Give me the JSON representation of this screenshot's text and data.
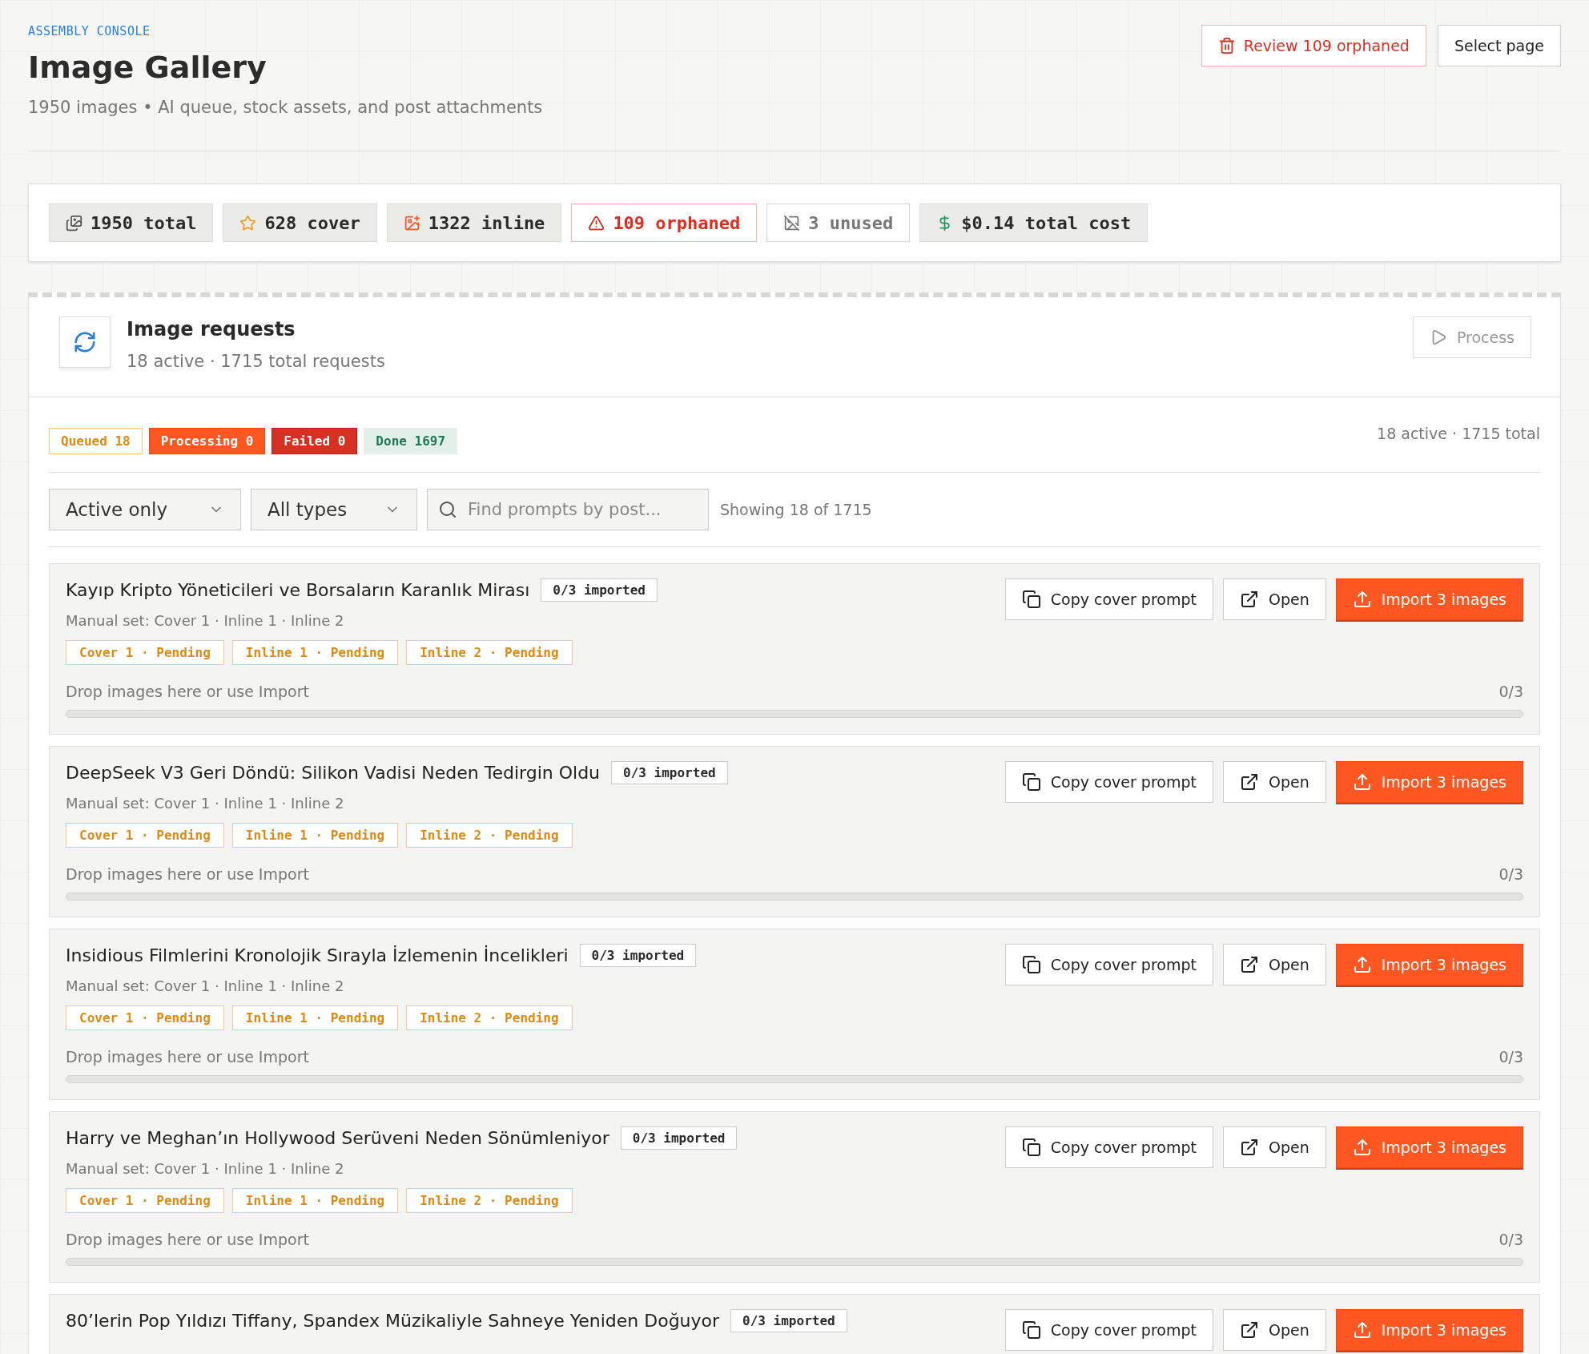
{
  "header": {
    "eyebrow": "ASSEMBLY CONSOLE",
    "title": "Image Gallery",
    "subtitle": "1950 images • AI queue, stock assets, and post attachments",
    "actions": [
      {
        "kind": "danger",
        "label": "Review 109 orphaned"
      },
      {
        "kind": "plain",
        "label": "Select page"
      }
    ]
  },
  "stats": [
    {
      "kind": "total",
      "label": "1950 total"
    },
    {
      "kind": "cover",
      "label": "628 cover"
    },
    {
      "kind": "inline",
      "label": "1322 inline"
    },
    {
      "kind": "orphaned",
      "label": "109 orphaned"
    },
    {
      "kind": "unused",
      "label": "3 unused"
    },
    {
      "kind": "cost",
      "label": "$0.14 total cost"
    }
  ],
  "requests": {
    "title": "Image requests",
    "subtitle": "18 active · 1715 total requests",
    "process_button": {
      "label": "Process",
      "disabled": true
    },
    "status_chips": [
      {
        "kind": "queued",
        "label": "Queued 18"
      },
      {
        "kind": "processing",
        "label": "Processing 0"
      },
      {
        "kind": "failed",
        "label": "Failed 0"
      },
      {
        "kind": "done",
        "label": "Done 1697"
      }
    ],
    "summary": "18 active · 1715 total",
    "filters": {
      "status": "Active only",
      "type": "All types",
      "search_placeholder": "Find prompts by post...",
      "showing": "Showing 18 of 1715"
    },
    "items": [
      {
        "title": "Kayıp Kripto Yöneticileri ve Borsaların Karanlık Mirası",
        "badge": "0/3 imported",
        "manual_set": "Manual set: Cover 1 · Inline 1 · Inline 2",
        "tags": [
          "Cover 1 · Pending",
          "Inline 1 · Pending",
          "Inline 2 · Pending"
        ],
        "drop_hint": "Drop images here or use Import",
        "count": "0/3",
        "level": 0,
        "buttons": [
          "Copy cover prompt",
          "Open",
          "Import 3 images"
        ]
      },
      {
        "title": "DeepSeek V3 Geri Döndü: Silikon Vadisi Neden Tedirgin Oldu",
        "badge": "0/3 imported",
        "manual_set": "Manual set: Cover 1 · Inline 1 · Inline 2",
        "tags": [
          "Cover 1 · Pending",
          "Inline 1 · Pending",
          "Inline 2 · Pending"
        ],
        "drop_hint": "Drop images here or use Import",
        "count": "0/3",
        "level": 0,
        "buttons": [
          "Copy cover prompt",
          "Open",
          "Import 3 images"
        ]
      },
      {
        "title": "Insidious Filmlerini Kronolojik Sırayla İzlemenin İncelikleri",
        "badge": "0/3 imported",
        "manual_set": "Manual set: Cover 1 · Inline 1 · Inline 2",
        "tags": [
          "Cover 1 · Pending",
          "Inline 1 · Pending",
          "Inline 2 · Pending"
        ],
        "drop_hint": "Drop images here or use Import",
        "count": "0/3",
        "level": 0,
        "buttons": [
          "Copy cover prompt",
          "Open",
          "Import 3 images"
        ]
      },
      {
        "title": "Harry ve Meghan’ın Hollywood Serüveni Neden Sönümleniyor",
        "badge": "0/3 imported",
        "manual_set": "Manual set: Cover 1 · Inline 1 · Inline 2",
        "tags": [
          "Cover 1 · Pending",
          "Inline 1 · Pending",
          "Inline 2 · Pending"
        ],
        "drop_hint": "Drop images here or use Import",
        "count": "0/3",
        "level": 0,
        "buttons": [
          "Copy cover prompt",
          "Open",
          "Import 3 images"
        ]
      },
      {
        "title": "80’lerin Pop Yıldızı Tiffany, Spandex Müzikaliyle Sahneye Yeniden Doğuyor",
        "badge": "0/3 imported",
        "buttons": [
          "Copy cover prompt",
          "Open",
          "Import 3 images"
        ]
      }
    ]
  }
}
